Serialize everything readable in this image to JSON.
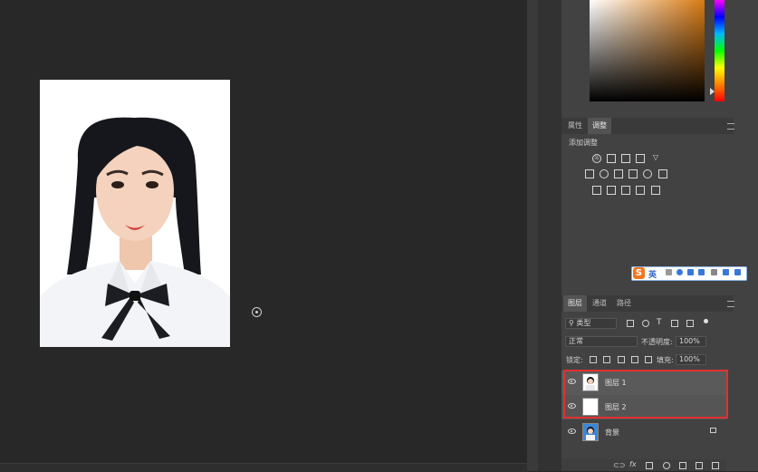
{
  "colors": {
    "selection_outline": "#e23030",
    "ime_brand": "#f07820"
  },
  "properties_panel": {
    "tabs": [
      "属性",
      "调整"
    ],
    "active_tab": "调整",
    "add_adjustment_label": "添加调整"
  },
  "ime_toolbar": {
    "logo": "S",
    "language": "英"
  },
  "layers_panel": {
    "tabs": [
      "图层",
      "通道",
      "路径"
    ],
    "filter_kind": "类型",
    "blend_mode": "正常",
    "opacity_label": "不透明度:",
    "opacity_value": "100%",
    "lock_label": "锁定:",
    "fill_label": "填充:",
    "fill_value": "100%",
    "layers": [
      {
        "name": "图层 1"
      },
      {
        "name": "图层 2"
      },
      {
        "name": "背景"
      }
    ]
  },
  "icons": [
    "eye-icon",
    "lock-icon",
    "link-icon",
    "fx-icon",
    "mask-icon",
    "folder-icon",
    "new-layer-icon",
    "trash-icon",
    "cursor-target-icon"
  ]
}
